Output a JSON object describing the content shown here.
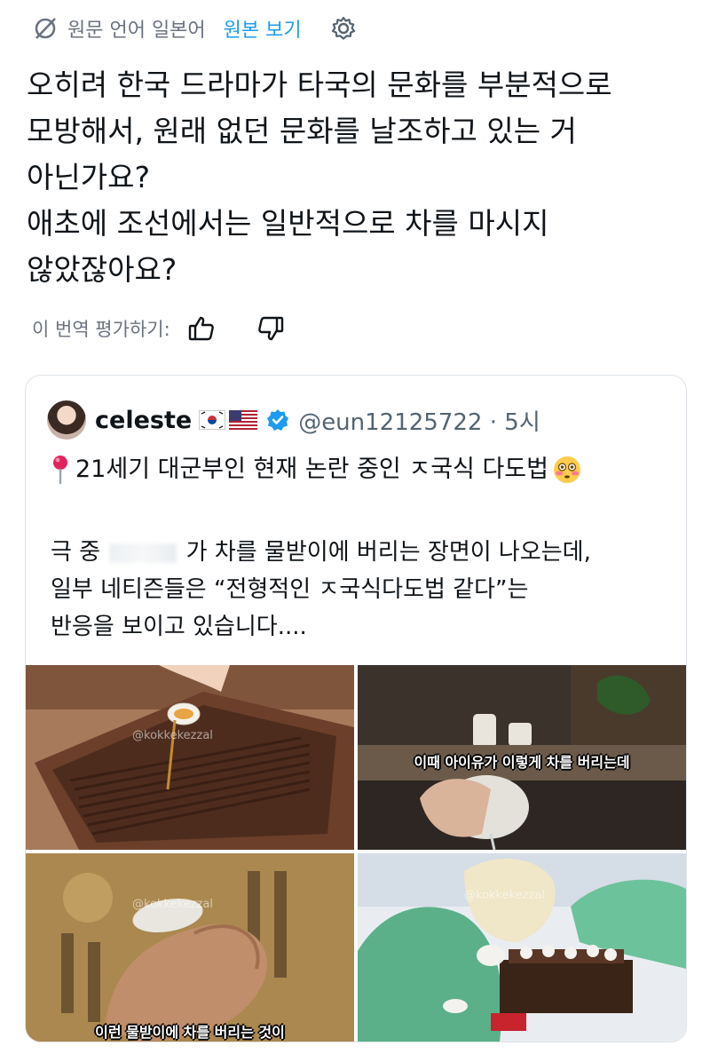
{
  "translation_bar": {
    "source_language": "원문 언어 일본어",
    "view_original": "원본 보기"
  },
  "post": {
    "lines": [
      "오히려 한국 드라마가 타국의 문화를 부분적으로",
      "모방해서, 원래 없던 문화를 날조하고 있는 거",
      "아닌가요?",
      "애초에 조선에서는 일반적으로 차를 마시지",
      "않았잖아요?"
    ]
  },
  "rating": {
    "label": "이 번역 평가하기:"
  },
  "quote": {
    "author_name": "celeste",
    "handle_time": "@eun12125722 · 5시",
    "title": "21세기 대군부인 현재 논란 중인 ㅈ국식 다도법",
    "body_line1_start": "극 중",
    "body_line1_end": "가 차를 물받이에 버리는 장면이 나오는데,",
    "body_line2": "일부 네티즌들은 “전형적인 ㅈ국식다도법 같다”는",
    "body_line3": "반응을 보이고 있습니다....",
    "media": {
      "caption_top_right": "이때 아이유가 이렇게 차를 버리는데",
      "caption_bottom_left": "이런 물받이에 차를 버리는 것이",
      "watermark": "@kokkekezzal"
    }
  },
  "colors": {
    "accent": "#1d9bf0",
    "muted": "#6b7280",
    "border": "#dfe3e7"
  }
}
